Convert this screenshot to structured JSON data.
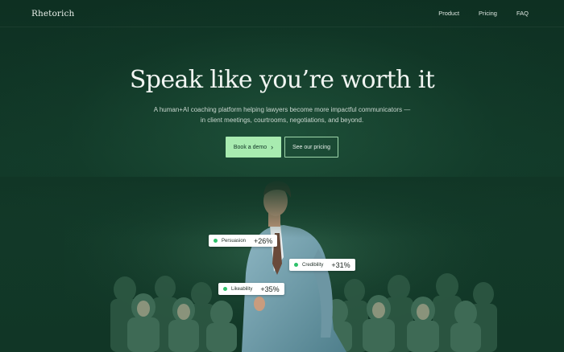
{
  "nav": {
    "logo": "Rhetorich",
    "links": [
      "Product",
      "Pricing",
      "FAQ"
    ]
  },
  "hero": {
    "title": "Speak like you’re worth it",
    "subtitle": "A human+AI coaching platform helping lawyers become more impactful communicators — in client meetings, courtrooms, negotiations, and beyond.",
    "primary_cta": "Book a demo",
    "secondary_cta": "See our pricing"
  },
  "badges": [
    {
      "label": "Persuasion",
      "value": "+26%"
    },
    {
      "label": "Credibility",
      "value": "+31%"
    },
    {
      "label": "Likeability",
      "value": "+35%"
    }
  ],
  "colors": {
    "background": "#0f3324",
    "accent": "#a8ebb0",
    "badge_dot": "#2ec16a"
  },
  "icons": {
    "cta_arrow": "chevron-right-icon",
    "badge_indicator": "green-dot-icon"
  }
}
